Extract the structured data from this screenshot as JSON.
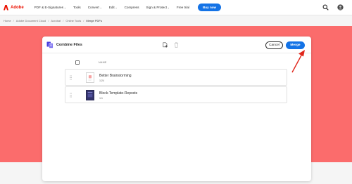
{
  "brand": {
    "name": "Adobe",
    "color": "#eb1000"
  },
  "nav": {
    "items": [
      {
        "label": "PDF & E-Signatures",
        "dropdown": true
      },
      {
        "label": "Tools",
        "dropdown": false
      },
      {
        "label": "Convert",
        "dropdown": true
      },
      {
        "label": "Edit",
        "dropdown": true
      },
      {
        "label": "Compress",
        "dropdown": false
      },
      {
        "label": "Sign & Protect",
        "dropdown": true
      },
      {
        "label": "Free trial",
        "dropdown": false
      }
    ],
    "buy_label": "Buy now",
    "chevron": "⌄",
    "icons": [
      "search-icon",
      "account-icon"
    ]
  },
  "breadcrumb": {
    "items": [
      "Home",
      "Adobe Document Cloud",
      "Acrobat",
      "Online Tools",
      "Merge PDFs"
    ],
    "separator": "/"
  },
  "panel": {
    "title": "Combine Files",
    "cancel_label": "Cancel",
    "merge_label": "Merge",
    "column_name": "NAME",
    "files": [
      {
        "name": "Better Brainstorming",
        "size": "1/24",
        "thumb": "light"
      },
      {
        "name": "Block-Template-Reposts",
        "size": "1/1",
        "thumb": "dark"
      }
    ]
  },
  "colors": {
    "banner": "#fb6c6c",
    "accent": "#1473e6",
    "arrow": "#e0261b"
  }
}
